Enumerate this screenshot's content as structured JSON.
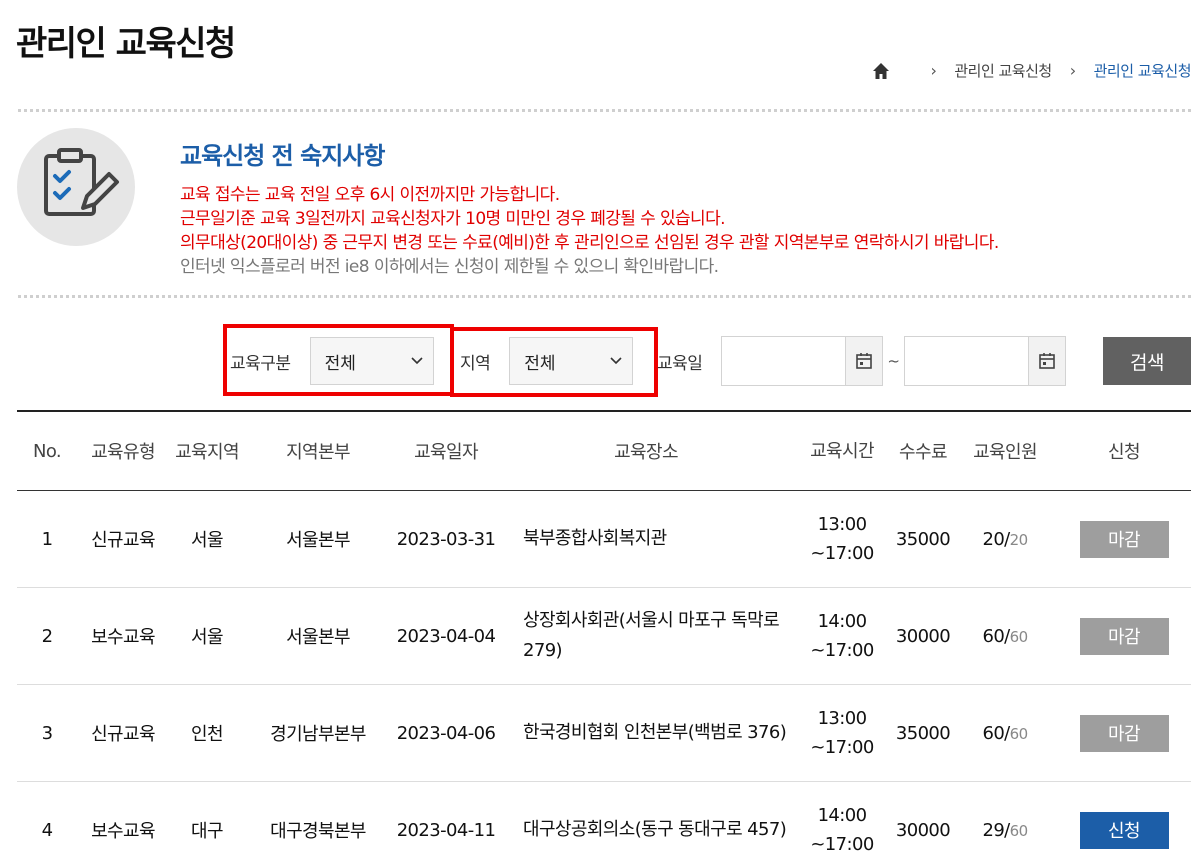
{
  "page_title": "관리인 교육신청",
  "breadcrumb": {
    "home_icon": "home-icon",
    "items": [
      "관리인 교육신청",
      "관리인 교육신청"
    ]
  },
  "notice": {
    "icon": "clipboard-check-icon",
    "title": "교육신청 전 숙지사항",
    "lines_red": [
      "교육 접수는 교육 전일 오후 6시 이전까지만 가능합니다.",
      "근무일기준 교육 3일전까지 교육신청자가 10명 미만인 경우 폐강될 수 있습니다.",
      "의무대상(20대이상) 중 근무지 변경 또는 수료(예비)한 후 관리인으로 선임된 경우 관할 지역본부로 연락하시기 바랍니다."
    ],
    "line_gray": "인터넷 익스플로러 버전 ie8 이하에서는 신청이 제한될 수 있으니 확인바랍니다."
  },
  "filters": {
    "type_label": "교육구분",
    "type_value": "전체",
    "region_label": "지역",
    "region_value": "전체",
    "date_label": "교육일",
    "date_from": "",
    "date_to": "",
    "date_sep": "~",
    "search_label": "검색"
  },
  "table": {
    "headers": [
      "No.",
      "교육유형",
      "교육지역",
      "지역본부",
      "교육일자",
      "교육장소",
      "교육시간",
      "수수료",
      "교육인원",
      "신청"
    ],
    "rows": [
      {
        "no": "1",
        "type": "신규교육",
        "region": "서울",
        "hq": "서울본부",
        "date": "2023-03-31",
        "place": "북부종합사회복지관",
        "time_start": "13:00",
        "time_end": "~17:00",
        "fee": "35000",
        "count": "20/",
        "max": "20",
        "action": "마감"
      },
      {
        "no": "2",
        "type": "보수교육",
        "region": "서울",
        "hq": "서울본부",
        "date": "2023-04-04",
        "place": "상장회사회관(서울시 마포구 독막로 279)",
        "time_start": "14:00",
        "time_end": "~17:00",
        "fee": "30000",
        "count": "60/",
        "max": "60",
        "action": "마감"
      },
      {
        "no": "3",
        "type": "신규교육",
        "region": "인천",
        "hq": "경기남부본부",
        "date": "2023-04-06",
        "place": "한국경비협회 인천본부(백범로 376)",
        "time_start": "13:00",
        "time_end": "~17:00",
        "fee": "35000",
        "count": "60/",
        "max": "60",
        "action": "마감"
      },
      {
        "no": "4",
        "type": "보수교육",
        "region": "대구",
        "hq": "대구경북본부",
        "date": "2023-04-11",
        "place": "대구상공회의소(동구 동대구로 457)",
        "time_start": "14:00",
        "time_end": "~17:00",
        "fee": "30000",
        "count": "29/",
        "max": "60",
        "action": "신청"
      }
    ]
  },
  "colors": {
    "accent": "#1c5ea8",
    "notice_red": "#e00000",
    "highlight_box": "#ee0000",
    "closed_button": "#9e9e9e"
  }
}
